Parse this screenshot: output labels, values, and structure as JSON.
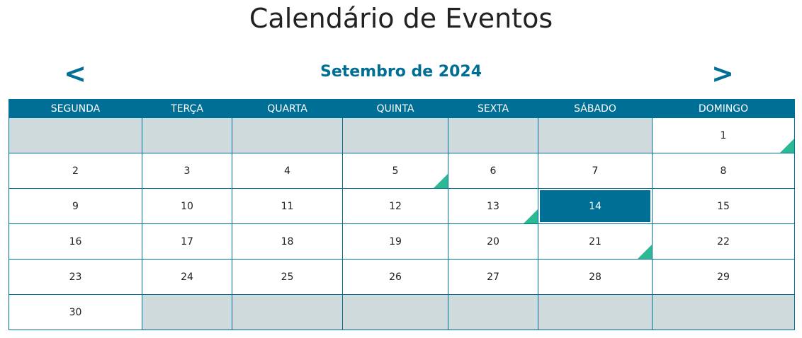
{
  "page": {
    "title": "Calendário de Eventos"
  },
  "nav": {
    "prev_label": "<",
    "next_label": ">",
    "month_label": "Setembro de 2024"
  },
  "colors": {
    "primary": "#006f96",
    "empty_cell": "#cfdadc",
    "event_marker": "#2bb894"
  },
  "weekdays": [
    "SEGUNDA",
    "TERÇA",
    "QUARTA",
    "QUINTA",
    "SEXTA",
    "SÁBADO",
    "DOMINGO"
  ],
  "weeks": [
    [
      {
        "day": ""
      },
      {
        "day": ""
      },
      {
        "day": ""
      },
      {
        "day": ""
      },
      {
        "day": ""
      },
      {
        "day": ""
      },
      {
        "day": "1",
        "event": true
      }
    ],
    [
      {
        "day": "2"
      },
      {
        "day": "3"
      },
      {
        "day": "4"
      },
      {
        "day": "5",
        "event": true
      },
      {
        "day": "6"
      },
      {
        "day": "7"
      },
      {
        "day": "8"
      }
    ],
    [
      {
        "day": "9"
      },
      {
        "day": "10"
      },
      {
        "day": "11"
      },
      {
        "day": "12"
      },
      {
        "day": "13",
        "event": true
      },
      {
        "day": "14",
        "today": true
      },
      {
        "day": "15"
      }
    ],
    [
      {
        "day": "16"
      },
      {
        "day": "17"
      },
      {
        "day": "18"
      },
      {
        "day": "19"
      },
      {
        "day": "20"
      },
      {
        "day": "21",
        "event": true
      },
      {
        "day": "22"
      }
    ],
    [
      {
        "day": "23"
      },
      {
        "day": "24"
      },
      {
        "day": "25"
      },
      {
        "day": "26"
      },
      {
        "day": "27"
      },
      {
        "day": "28"
      },
      {
        "day": "29"
      }
    ],
    [
      {
        "day": "30"
      },
      {
        "day": ""
      },
      {
        "day": ""
      },
      {
        "day": ""
      },
      {
        "day": ""
      },
      {
        "day": ""
      },
      {
        "day": ""
      }
    ]
  ]
}
